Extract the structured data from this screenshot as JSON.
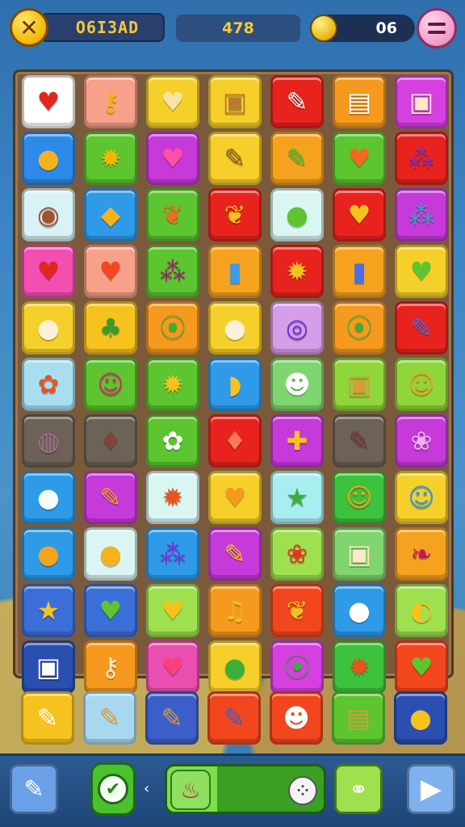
{
  "header": {
    "player_name": "O6I3AD",
    "score": "478",
    "coins": "06"
  },
  "icons": {
    "close": "x-icon",
    "coin": "coin-icon",
    "menu": "menu-icon",
    "pencil": "pencil-icon",
    "check": "check-icon",
    "play": "play-icon"
  },
  "board": {
    "columns": 7,
    "rows": [
      [
        {
          "item": "heart",
          "bg": "#ffffff",
          "fg": "#e0261f"
        },
        {
          "item": "key",
          "bg": "#f7a08a",
          "fg": "#f2b705"
        },
        {
          "item": "heart",
          "bg": "#f6d02a",
          "fg": "#f7e3a8"
        },
        {
          "item": "box",
          "bg": "#f6cf2a",
          "fg": "#b97a32"
        },
        {
          "item": "pencil",
          "bg": "#e8231e",
          "fg": "#ffffff"
        },
        {
          "item": "book",
          "bg": "#f59a1e",
          "fg": "#ffffff"
        },
        {
          "item": "box",
          "bg": "#d63fe0",
          "fg": "#ffe8c6"
        }
      ],
      [
        {
          "item": "lemon",
          "bg": "#2e8ae8",
          "fg": "#f5b21e"
        },
        {
          "item": "sun",
          "bg": "#5cc52f",
          "fg": "#f2b705"
        },
        {
          "item": "heart",
          "bg": "#c53ad8",
          "fg": "#ff4fa3"
        },
        {
          "item": "pencil",
          "bg": "#f6cf2a",
          "fg": "#8a5a20"
        },
        {
          "item": "pencil",
          "bg": "#f5a21e",
          "fg": "#3cc23c"
        },
        {
          "item": "heart",
          "bg": "#5cc52f",
          "fg": "#f36a1e"
        },
        {
          "item": "grape",
          "bg": "#e8231e",
          "fg": "#7a2fb8"
        }
      ],
      [
        {
          "item": "cookie",
          "bg": "#d9f2f6",
          "fg": "#a0522d"
        },
        {
          "item": "duck",
          "bg": "#2e9ae8",
          "fg": "#f5b21e"
        },
        {
          "item": "leaf",
          "bg": "#5cc52f",
          "fg": "#f36a1e"
        },
        {
          "item": "leaf",
          "bg": "#e8231e",
          "fg": "#f5c21e"
        },
        {
          "item": "ball",
          "bg": "#d9f6f3",
          "fg": "#5cc52f"
        },
        {
          "item": "heart",
          "bg": "#e8231e",
          "fg": "#f5c21e"
        },
        {
          "item": "grape",
          "bg": "#c53ad8",
          "fg": "#2ea6b8"
        }
      ],
      [
        {
          "item": "heart",
          "bg": "#f24fb0",
          "fg": "#e0261f"
        },
        {
          "item": "heart",
          "bg": "#f7a08a",
          "fg": "#f1461e"
        },
        {
          "item": "grape",
          "bg": "#5cc52f",
          "fg": "#a0206e"
        },
        {
          "item": "popsicle",
          "bg": "#f5a21e",
          "fg": "#3c9ae8"
        },
        {
          "item": "sun",
          "bg": "#e8231e",
          "fg": "#f5c21e"
        },
        {
          "item": "popsicle",
          "bg": "#f5a21e",
          "fg": "#4a6ee8"
        },
        {
          "item": "heart",
          "bg": "#f6d02a",
          "fg": "#5cc52f"
        }
      ],
      [
        {
          "item": "ball",
          "bg": "#f6d02a",
          "fg": "#fbf1d8"
        },
        {
          "item": "clover",
          "bg": "#f5c21e",
          "fg": "#3c9a2c"
        },
        {
          "item": "pea",
          "bg": "#f59a1e",
          "fg": "#3ab03a"
        },
        {
          "item": "ball",
          "bg": "#f6d02a",
          "fg": "#fbf1d8"
        },
        {
          "item": "ring",
          "bg": "#d69ee8",
          "fg": "#6a2fd8"
        },
        {
          "item": "pea",
          "bg": "#f59a1e",
          "fg": "#3ab03a"
        },
        {
          "item": "pencil",
          "bg": "#e8231e",
          "fg": "#4a6ee8"
        }
      ],
      [
        {
          "item": "bug",
          "bg": "#a8dff0",
          "fg": "#e8541e"
        },
        {
          "item": "face",
          "bg": "#5cc52f",
          "fg": "#e0266f"
        },
        {
          "item": "sun",
          "bg": "#5cc52f",
          "fg": "#f5c21e"
        },
        {
          "item": "bread",
          "bg": "#2e9ae8",
          "fg": "#f5c21e"
        },
        {
          "item": "cat",
          "bg": "#7fd66e",
          "fg": "#ffffff"
        },
        {
          "item": "box",
          "bg": "#8ed63a",
          "fg": "#d89a3a"
        },
        {
          "item": "face",
          "bg": "#8ed63a",
          "fg": "#f5a21e"
        }
      ],
      [
        {
          "item": "lollipop",
          "bg": "#8a6a4b",
          "fg": "#e86aa8",
          "dim": true
        },
        {
          "item": "strawberry",
          "bg": "#8a6a4b",
          "fg": "#e8331e",
          "dim": true
        },
        {
          "item": "bug",
          "bg": "#5cc52f",
          "fg": "#ffffff"
        },
        {
          "item": "strawberry",
          "bg": "#e8231e",
          "fg": "#ff7a5a"
        },
        {
          "item": "gift",
          "bg": "#c53ad8",
          "fg": "#f5c21e"
        },
        {
          "item": "pencil",
          "bg": "#8a6a4b",
          "fg": "#e8231e",
          "dim": true
        },
        {
          "item": "flower",
          "bg": "#c53ad8",
          "fg": "#f0b0f0"
        }
      ],
      [
        {
          "item": "ball",
          "bg": "#2e9ae8",
          "fg": "#f3fbfb"
        },
        {
          "item": "pencil",
          "bg": "#c53ad8",
          "fg": "#f5a21e"
        },
        {
          "item": "sun",
          "bg": "#d9f6f3",
          "fg": "#e8541e"
        },
        {
          "item": "heart",
          "bg": "#f6cf2a",
          "fg": "#f59a1e"
        },
        {
          "item": "star",
          "bg": "#a8eef0",
          "fg": "#3ab03a"
        },
        {
          "item": "face",
          "bg": "#3cc23c",
          "fg": "#f5a21e"
        },
        {
          "item": "face",
          "bg": "#f6d02a",
          "fg": "#2e9ae8"
        }
      ],
      [
        {
          "item": "orange",
          "bg": "#2e9ae8",
          "fg": "#f5a21e"
        },
        {
          "item": "lemon",
          "bg": "#d9f6f3",
          "fg": "#f5b21e"
        },
        {
          "item": "grape",
          "bg": "#2e9ae8",
          "fg": "#7a2fd8"
        },
        {
          "item": "pencil",
          "bg": "#c53ad8",
          "fg": "#f5c21e"
        },
        {
          "item": "flower",
          "bg": "#9ee04e",
          "fg": "#e8331e"
        },
        {
          "item": "box",
          "bg": "#7fd66e",
          "fg": "#ffe8c6"
        },
        {
          "item": "cherry",
          "bg": "#f5a21e",
          "fg": "#c2185b"
        }
      ],
      [
        {
          "item": "star",
          "bg": "#3c6ed8",
          "fg": "#f5c21e"
        },
        {
          "item": "heart",
          "bg": "#3c6ed8",
          "fg": "#5cc52f"
        },
        {
          "item": "heart",
          "bg": "#9ee04e",
          "fg": "#f5c21e"
        },
        {
          "item": "bell",
          "bg": "#f59a1e",
          "fg": "#f5c21e"
        },
        {
          "item": "leaf",
          "bg": "#f1461e",
          "fg": "#f5c21e"
        },
        {
          "item": "ball",
          "bg": "#2e9ae8",
          "fg": "#ffffff"
        },
        {
          "item": "nut",
          "bg": "#9ee04e",
          "fg": "#f5c21e"
        }
      ],
      [
        {
          "item": "box",
          "bg": "#2a4fb0",
          "fg": "#ffffff"
        },
        {
          "item": "key",
          "bg": "#f59a1e",
          "fg": "#ffe8c6"
        },
        {
          "item": "heart",
          "bg": "#e84fb0",
          "fg": "#ff3f7a"
        },
        {
          "item": "ball",
          "bg": "#f6cf2a",
          "fg": "#3ab03a"
        },
        {
          "item": "pea",
          "bg": "#d63fe0",
          "fg": "#3ab03a"
        },
        {
          "item": "sun",
          "bg": "#3cc23c",
          "fg": "#e8541e"
        },
        {
          "item": "heart",
          "bg": "#f1461e",
          "fg": "#5cc52f"
        }
      ]
    ]
  },
  "tray": [
    {
      "item": "pencil",
      "bg": "#f5c21e",
      "fg": "#ffffff"
    },
    {
      "item": "pencil",
      "bg": "#a8d8f0",
      "fg": "#d89a3a"
    },
    {
      "item": "pencil",
      "bg": "#3c5ec8",
      "fg": "#d89a3a"
    },
    {
      "item": "pencil",
      "bg": "#f1461e",
      "fg": "#3c5ec8"
    },
    {
      "item": "cat",
      "bg": "#f1461e",
      "fg": "#ffffff"
    },
    {
      "item": "book",
      "bg": "#5cc52f",
      "fg": "#d89a3a"
    },
    {
      "item": "lemon",
      "bg": "#2a4fb0",
      "fg": "#f5c21e"
    }
  ],
  "progress": {
    "fill_fraction": 0.32,
    "current_item": "cake"
  }
}
